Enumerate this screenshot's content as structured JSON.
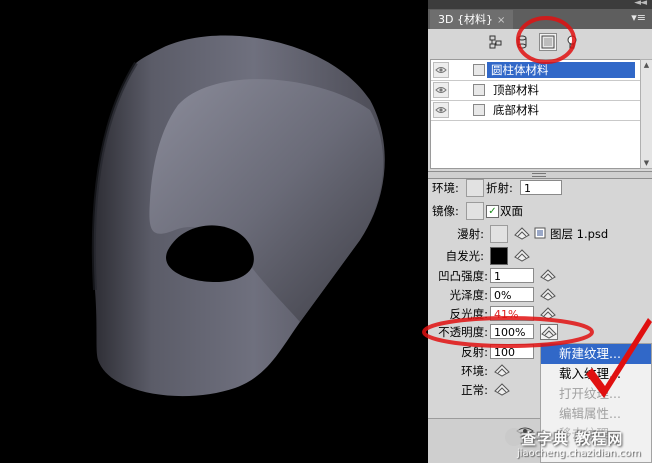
{
  "panel": {
    "tab_label": "3D {材料}",
    "tab_close": "×",
    "collapse_glyph": "◄◄",
    "menu_glyph": "▾≡",
    "filter_icons": [
      "scene-filter-icon",
      "mesh-filter-icon",
      "material-filter-icon",
      "light-filter-icon"
    ],
    "materials": [
      {
        "label": "圆柱体材料",
        "active": true
      },
      {
        "label": "顶部材料",
        "active": false
      },
      {
        "label": "底部材料",
        "active": false
      }
    ]
  },
  "props": {
    "ambient_label": "环境:",
    "refraction_label": "折射:",
    "refraction_value": "1",
    "mirror_label": "镜像:",
    "double_sided_label": "双面",
    "diffuse_label": "漫射:",
    "diffuse_texture_name": "图层 1.psd",
    "self_illum_label": "自发光:",
    "bump_label": "凹凸强度:",
    "bump_value": "1",
    "gloss_label": "光泽度:",
    "gloss_value": "0%",
    "shine_label": "反光度:",
    "shine_value": "41%",
    "opacity_label": "不透明度:",
    "opacity_value": "100%",
    "reflection_label": "反射:",
    "reflection_value": "100",
    "environment_label": "环境:",
    "normal_label": "正常:"
  },
  "context_menu": {
    "items": [
      {
        "label": "新建纹理...",
        "state": "selected"
      },
      {
        "label": "载入纹理...",
        "state": "enabled"
      },
      {
        "label": "打开纹理...",
        "state": "disabled"
      },
      {
        "label": "编辑属性...",
        "state": "disabled"
      },
      {
        "label": "移去纹理...",
        "state": "disabled"
      }
    ]
  },
  "watermark": {
    "line1": "查字典 教程网",
    "line2": "jiaocheng.chazidian.com"
  },
  "colors": {
    "selection": "#3168c8",
    "annotation_red": "#e01010",
    "panel_bg": "#d6d6d6"
  }
}
